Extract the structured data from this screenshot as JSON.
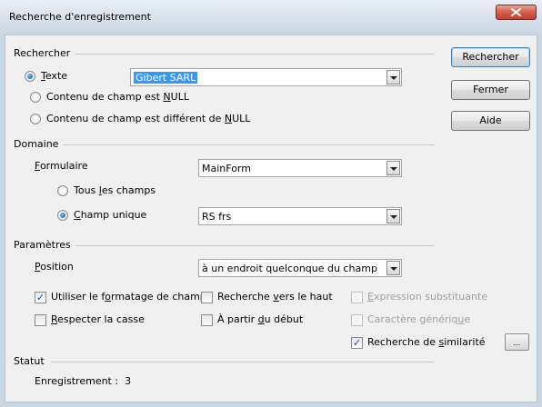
{
  "window": {
    "title": "Recherche d'enregistrement",
    "close_glyph": "x"
  },
  "buttons": {
    "search_label": "Rechercher",
    "close_label": "Fermer",
    "help_label": "Aide",
    "similarity_options_label": "..."
  },
  "search_group": {
    "label": "Rechercher",
    "text_radio": {
      "prefix": "",
      "mnemonic": "T",
      "rest": "exte",
      "selected": true
    },
    "text_value": "Gibert SARL",
    "null_radio": {
      "prefix": "Contenu de champ est ",
      "mnemonic": "N",
      "rest": "ULL",
      "selected": false
    },
    "not_null_radio": {
      "prefix": "Contenu de champ est différent de ",
      "mnemonic": "N",
      "rest": "ULL",
      "selected": false
    }
  },
  "domain_group": {
    "label": "Domaine",
    "form_label": {
      "prefix": "",
      "mnemonic": "F",
      "rest": "ormulaire"
    },
    "form_value": "MainForm",
    "all_fields_radio": {
      "prefix": "Tous ",
      "mnemonic": "l",
      "rest": "es champs",
      "selected": false
    },
    "single_field_radio": {
      "prefix": "",
      "mnemonic": "C",
      "rest": "hamp unique",
      "selected": true
    },
    "field_value": "RS frs"
  },
  "params_group": {
    "label": "Paramètres",
    "position_label": {
      "prefix": "",
      "mnemonic": "P",
      "rest": "osition"
    },
    "position_value": "à un endroit quelconque du champ",
    "options": {
      "field_format": {
        "prefix": "Utiliser le f",
        "mnemonic": "o",
        "rest": "rmatage de champ",
        "checked": true,
        "enabled": true
      },
      "search_up": {
        "prefix": "Recherche ",
        "mnemonic": "v",
        "rest": "ers le haut",
        "checked": false,
        "enabled": true
      },
      "regex": {
        "prefix": "",
        "mnemonic": "E",
        "rest": "xpression substituante",
        "checked": false,
        "enabled": false
      },
      "match_case": {
        "prefix": "",
        "mnemonic": "R",
        "rest": "especter la casse",
        "checked": false,
        "enabled": true
      },
      "from_start": {
        "prefix": "À partir ",
        "mnemonic": "d",
        "rest": "u début",
        "checked": false,
        "enabled": true
      },
      "wildcard": {
        "prefix": "Caractère génériq",
        "mnemonic": "u",
        "rest": "e",
        "checked": false,
        "enabled": false
      },
      "similarity": {
        "prefix": "Recherche de ",
        "mnemonic": "s",
        "rest": "imilarité",
        "checked": true,
        "enabled": true
      }
    }
  },
  "status_group": {
    "label": "Statut",
    "record_text": "Enregistrement :  3"
  },
  "colors": {
    "accent": "#3399ff",
    "close_button": "#c2402b",
    "disabled_text": "#a0a0a0"
  }
}
